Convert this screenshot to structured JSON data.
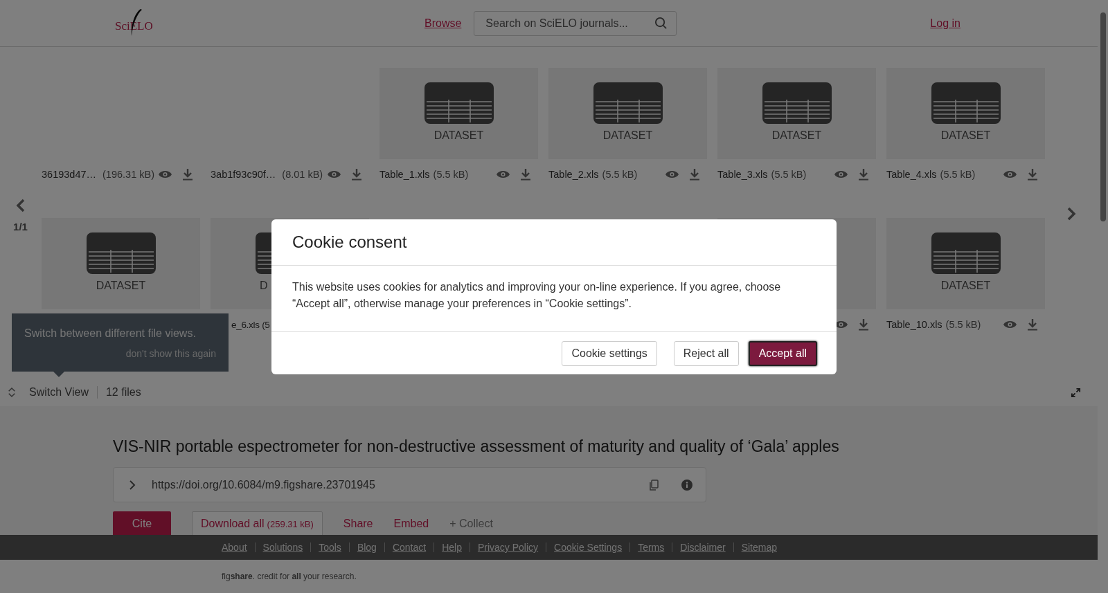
{
  "header": {
    "logo": "SciELO",
    "nav_link": "Browse",
    "search": {
      "placeholder": "Search on SciELO journals..."
    },
    "login": "Log in"
  },
  "carousel": {
    "page": "1/1",
    "rows": [
      [
        {
          "kind": "no-preview",
          "name": "36193d47…",
          "size": "(196.31 kB)",
          "actions": true
        },
        {
          "kind": "no-preview",
          "name": "3ab1f93c90f…",
          "size": "(8.01 kB)",
          "actions": true
        },
        {
          "kind": "dataset",
          "thumb_label": "DATASET",
          "name": "Table_1.xls",
          "size": "(5.5 kB)",
          "actions": true
        },
        {
          "kind": "dataset",
          "thumb_label": "DATASET",
          "name": "Table_2.xls",
          "size": "(5.5 kB)",
          "actions": true
        },
        {
          "kind": "dataset",
          "thumb_label": "DATASET",
          "name": "Table_3.xls",
          "size": "(5.5 kB)",
          "actions": true
        },
        {
          "kind": "dataset",
          "thumb_label": "DATASET",
          "name": "Table_4.xls",
          "size": "(5.5 kB)",
          "actions": true
        }
      ],
      [
        {
          "kind": "dataset",
          "thumb_label": "DATASET"
        },
        {
          "kind": "dataset-cut",
          "thumb_label": "D",
          "caption": "e_6.xls (5"
        },
        {
          "kind": "covered"
        },
        {
          "kind": "covered"
        },
        {
          "kind": "blank-thumb",
          "actions": true
        },
        {
          "kind": "dataset",
          "thumb_label": "DATASET",
          "name": "Table_10.xls",
          "size": "(5.5 kB)",
          "actions": true
        }
      ]
    ]
  },
  "tooltip": {
    "text": "Switch between different file views.",
    "dismiss": "don't show this again"
  },
  "view_bar": {
    "switch": "Switch View",
    "count": "12 files"
  },
  "item": {
    "title": "VIS-NIR portable espectrometer for non-destructive assessment of maturity and quality of ‘Gala’ apples",
    "doi": "https://doi.org/10.6084/m9.figshare.23701945",
    "actions": [
      {
        "kind": "primary",
        "label": "Cite"
      },
      {
        "kind": "outlined",
        "label": "Download all",
        "note": "(259.31 kB)"
      },
      {
        "kind": "link",
        "label": "Share"
      },
      {
        "kind": "link",
        "label": "Embed"
      },
      {
        "kind": "muted",
        "label": "+ Collect"
      }
    ]
  },
  "footer": {
    "links": [
      "About",
      "Solutions",
      "Tools",
      "Blog",
      "Contact",
      "Help",
      "Privacy Policy",
      "Cookie Settings",
      "Terms",
      "Disclaimer",
      "Sitemap"
    ],
    "tagline": "fig**share**. credit for **all** your research."
  },
  "modal": {
    "title": "Cookie consent",
    "body": "This website uses cookies for analytics and improving your on-line experience. If you agree, choose “Accept all”, otherwise manage your preferences in “Cookie settings”.",
    "buttons": [
      {
        "kind": "secondary",
        "label": "Cookie settings"
      },
      {
        "kind": "secondary",
        "label": "Reject all"
      },
      {
        "kind": "primary",
        "label": "Accept all"
      }
    ]
  }
}
